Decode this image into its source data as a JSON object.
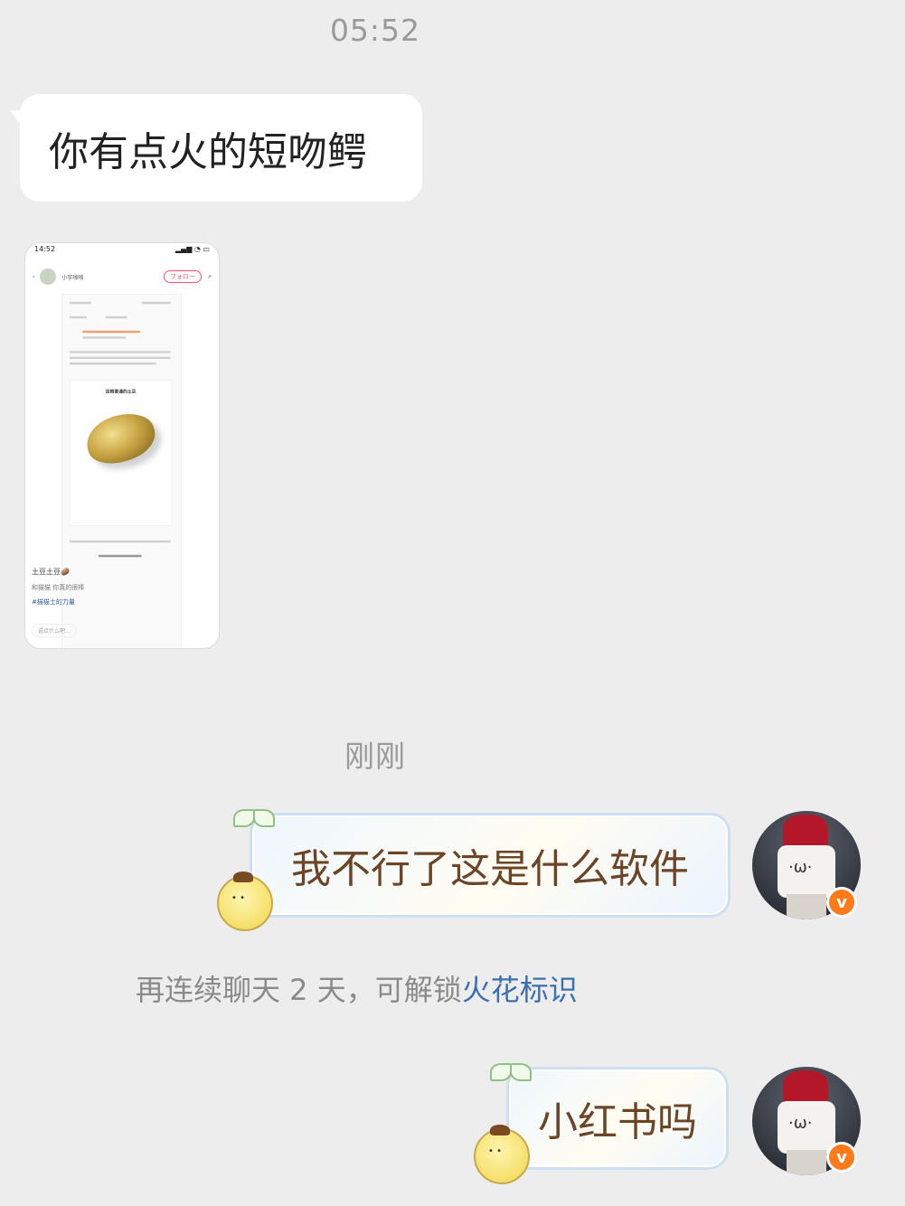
{
  "timestamps": {
    "first": "05:52",
    "second": "刚刚"
  },
  "incoming": {
    "text_message": "你有点火的短吻鳄",
    "shared_screenshot": {
      "status_time": "14:52",
      "author": "小宇啪啪",
      "follow_label": "フォロー",
      "card_title": "这根普通的土豆",
      "caption": "土豆土豆🥔",
      "caption2": "和猫猫 你真的很棒",
      "hashtag": "#猫猫土的力量",
      "comment_placeholder": "说点什么吧…"
    }
  },
  "outgoing": [
    {
      "text": "我不行了这是什么软件"
    },
    {
      "text": "小红书吗"
    }
  ],
  "system_notice": {
    "prefix": "再连续聊天 2 天，可解锁",
    "link": "火花标识"
  },
  "badge": {
    "label": "v"
  },
  "colors": {
    "background": "#ededed",
    "outgoing_text": "#6b4526",
    "link": "#3d6fb0",
    "badge": "#ff7a1a"
  }
}
